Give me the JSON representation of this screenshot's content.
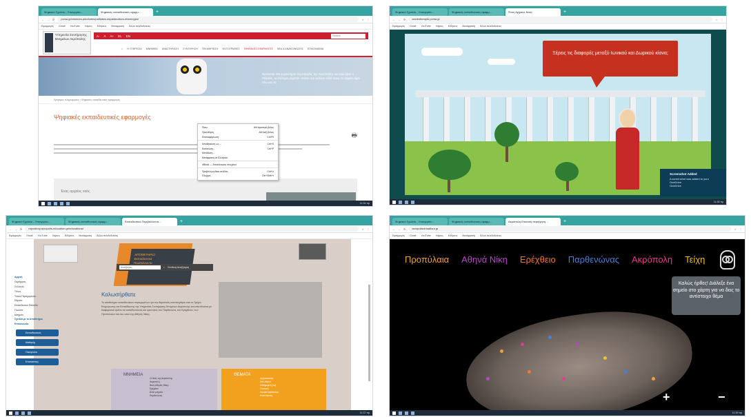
{
  "pane1": {
    "tabs": [
      "Ψηφιακό Σχολείο - Υπουργείο…",
      "Ψηφιακές εκπαιδευτικές εφαρμ…"
    ],
    "url": "pvma.gr/xrisimes-plirofories/psifiakes-ekpaideutikes-efarmoges/",
    "bookmarks": [
      "Εφαρμογές",
      "Gmail",
      "YouTube",
      "Χάρτες",
      "Ειδήσεις",
      "Μετάφραση",
      "Άλλοι σελιδοδείκτες"
    ],
    "logo_text": "Υπηρεσία Συντήρησης Μνημείων Ακρόπολης",
    "topbar": [
      "Α-",
      "Α",
      "Α+"
    ],
    "lang": [
      "EL",
      "EN"
    ],
    "search_placeholder": "Search",
    "nav": [
      "Η ΥΠΗΡΕΣΙΑ",
      "ΜΝΗΜΕΙΑ",
      "ΑΝΑΣΤΗΛΩΣΗ",
      "ΣΥΝΤΗΡΗΣΗ",
      "ΤΕΚΜΗΡΙΩΣΗ",
      "ΦΩΤΟΓΡΑΦΙΕΣ",
      "ΨΗΦΙΑΚΕΣ ΕΦΑΡΜΟΓΕΣ",
      "ΝΕΑ & ΑΝΑΚΟΙΝΩΣΕΙΣ",
      "ΕΠΙΚΟΙΝΩΝΙΑ"
    ],
    "hero_text": "Βρίσκεται στο εργαστήριο τεχνολογίας της Ακρόπολης και εγώ είμαι ο Πιξελάκ, το επίσημο ρομπότ. Ανήκει στο μέλλον αλλά προς το παρόν είμαι εδώ για να",
    "breadcrumb": "Χρήσιμες πληροφορίες › Ψηφιακές εκπαιδευτικές εφαρμογές",
    "page_title": "Ψηφιακές εκπαιδευτικές εφαρμογές",
    "context_menu": [
      {
        "label": "Πίσω",
        "key": "Alt+Αριστερό βέλος"
      },
      {
        "label": "Προώθηση",
        "key": "Alt+Δεξί βέλος"
      },
      {
        "label": "Επαναφόρτωση",
        "key": "Ctrl+R"
      },
      {
        "label": "Αποθήκευση ως…",
        "key": "Ctrl+S"
      },
      {
        "label": "Εκτύπωση…",
        "key": "Ctrl+P"
      },
      {
        "label": "Μετάδοση…",
        "key": ""
      },
      {
        "label": "Μετάφραση σε Ελληνικά",
        "key": ""
      },
      {
        "label": "uBlock — Αποκλεισμός στοιχείου",
        "key": ""
      },
      {
        "label": "Προβολή κώδικα σελίδας",
        "key": "Ctrl+U"
      },
      {
        "label": "Έλεγχος",
        "key": "Ctrl+Shift+I"
      }
    ],
    "card_label": "Ένας αρχαίος ναός",
    "clock": "11:34 πμ"
  },
  "pane2": {
    "tabs": [
      "Ψηφιακό Σχολείο - Υπουργείο…",
      "Ψηφιακές εκπαιδευτικές εφαρμ…",
      "Ένας Αρχαίος Ναός"
    ],
    "url": "ancienttemple.pvma.gr",
    "bookmarks": [
      "Εφαρμογές",
      "Gmail",
      "YouTube",
      "Χάρτες",
      "Ειδήσεις",
      "Μετάφραση",
      "Άλλοι σελιδοδείκτες"
    ],
    "speech": "Ξέρεις τις διαφορές μεταξύ Ιωνικού και Δωρικού κίονα;",
    "toast_title": "Screenshot Added",
    "toast_body": "A screenshot was added to your OneDrive.",
    "toast_app": "OneDrive",
    "clock": "11:36 πμ"
  },
  "pane3": {
    "tabs": [
      "Ψηφιακό Σχολείο - Υπουργείο…",
      "Ψηφιακές εκπαιδευτικές εφαρμ…",
      "Εκπαιδευτικά Περιβάλλοντα…"
    ],
    "url": "repository.acropolis-education.gr/educational",
    "bookmarks": [
      "Εφαρμογές",
      "Gmail",
      "YouTube",
      "Χάρτες",
      "Ειδήσεις",
      "Μετάφραση",
      "Άλλοι σελιδοδείκτες"
    ],
    "banner_lines": [
      "ΑΠΟΘΕΤΗΡΙΟ",
      "Εκπαιδευτικά",
      "Περιβάλλοντα",
      "για την ΑΚΡΟΠΟΛΗ"
    ],
    "search_placeholder": "Αναζήτηση",
    "search_adv": "Σύνθετη Αναζήτηση",
    "sidebar": [
      "Αρχική",
      "Περιήγηση",
      "Συλλογές",
      "Τίτλος",
      "Τύπος Περιεχομένου",
      "Θέματα",
      "Εκπαιδευτικό Επίπεδο",
      "Γλώσσα",
      "Μνημεία",
      "Σχετικά με το Αποθετήριο",
      "Επικοινωνία"
    ],
    "buttons": [
      "Εκπαιδευτικός",
      "Μαθητής",
      "Οικογένεια",
      "Επισκέπτης"
    ],
    "welcome_title": "Καλωσήρθατε",
    "welcome_text": "Το αποθετήριο εκπαιδευτικών περιεχομένων για την Ακρόπολη αναπτύχθηκε από το Τμήμα Ενημέρωσης και Εκπαίδευσης της Υπηρεσίας Συντήρησης Μνημείων Ακρόπολης και απευθύνεται με διαφορετικό τρόπο σε εκπαιδευτικούς και ερευνητές του Παρθενώνα, του Ερεχθείου, των Προπυλαίων και του ναού της Αθηνάς Νίκης.",
    "card_monuments": "ΜΝΗΜΕΙΑ",
    "monuments": [
      "Ο Ναός της Ακρόπολης",
      "Ακρόπολη",
      "Ναός Αθηνάς Νίκης",
      "Ερέχθειο",
      "Άλλα μνημεία",
      "Παρθενώνας"
    ],
    "card_themes": "ΘΕΜΑΤΑ",
    "themes": [
      "Αρχιτεκτονική",
      "Θεά Αθηνά",
      "Καθημερινή ζωή",
      "Γλυπτική",
      "Ιστορία Ακρόπολης",
      "Αναστήλωση"
    ],
    "clock": "11:37 πμ"
  },
  "pane4": {
    "tabs": [
      "Ψηφιακό Σχολείο - Υπουργείο…",
      "Ψηφιακές εκπαιδευτικές εφαρμ…",
      "Ακρόπολη Εικονική περιήγηση…"
    ],
    "url": "acropolisvirtualtour.gr",
    "bookmarks": [
      "Εφαρμογές",
      "Gmail",
      "YouTube",
      "Χάρτες",
      "Ειδήσεις",
      "Μετάφραση",
      "Άλλοι σελιδοδείκτες"
    ],
    "nav": [
      {
        "label": "Προπύλαια",
        "color": "#f2a23a"
      },
      {
        "label": "Αθηνά Νίκη",
        "color": "#b547c5"
      },
      {
        "label": "Ερέχθειο",
        "color": "#f07a2a"
      },
      {
        "label": "Παρθενώνας",
        "color": "#4a7fd8"
      },
      {
        "label": "Ακρόπολη",
        "color": "#e43d8c"
      },
      {
        "label": "Τείχη",
        "color": "#f5c02c"
      }
    ],
    "welcome": "Καλώς ήρθες! Διάλεξε ένα σημείο στο χάρτη για να δεις το αντίστοιχο θέμα",
    "zoom_in": "+",
    "zoom_out": "−",
    "clock": "11:39 πμ"
  }
}
